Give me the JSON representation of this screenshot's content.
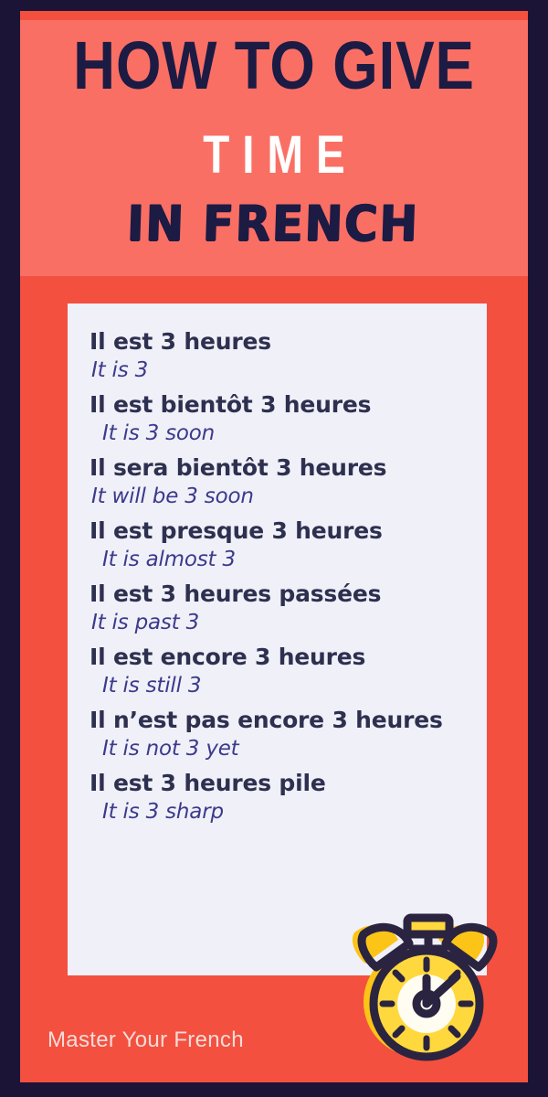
{
  "header": {
    "title_line1": "HOW TO GIVE",
    "title_line2": "TIME",
    "title_line3": "IN FRENCH"
  },
  "panel": {
    "phrases": [
      {
        "fr": "Il est 3 heures",
        "en": "It is 3"
      },
      {
        "fr": "Il est bientôt 3 heures",
        "en": "It is 3 soon"
      },
      {
        "fr": "Il sera bientôt 3 heures",
        "en": "It will be 3 soon"
      },
      {
        "fr": "Il est presque 3 heures",
        "en": "It is almost 3"
      },
      {
        "fr": "Il est 3 heures passées",
        "en": "It is past 3"
      },
      {
        "fr": "Il est encore 3 heures",
        "en": "It is still 3"
      },
      {
        "fr": "Il n’est pas encore 3 heures",
        "en": "It is not 3 yet"
      },
      {
        "fr": "Il est 3 heures pile",
        "en": "It is 3 sharp"
      }
    ]
  },
  "footer": {
    "brand": "Master Your French"
  },
  "colors": {
    "frame_navy": "#1c1436",
    "body_red": "#f4503f",
    "header_salmon": "#fa6f64",
    "panel_bg": "#f0f0f8",
    "heading_navy": "#2e3050",
    "italic_blue": "#3b3a8c",
    "title_navy": "#1c1b44",
    "clock_gold": "#fbc417",
    "clock_yellow": "#ffd83d",
    "clock_outline": "#2b2440",
    "clock_face": "#fffdf2",
    "footer_text": "#f5dcd8"
  }
}
